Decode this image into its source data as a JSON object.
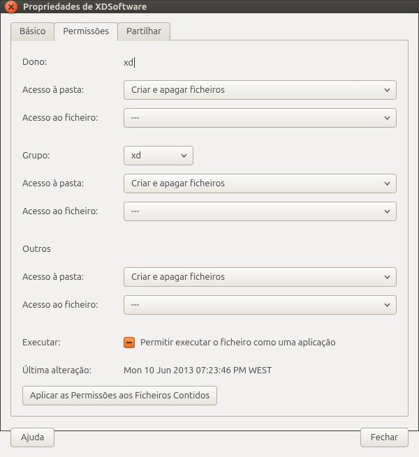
{
  "window": {
    "title": "Propriedades de XDSoftware"
  },
  "tabs": {
    "basic": "Básico",
    "permissions": "Permissões",
    "share": "Partilhar"
  },
  "labels": {
    "owner": "Dono:",
    "folder_access": "Acesso à pasta:",
    "file_access": "Acesso ao ficheiro:",
    "group": "Grupo:",
    "others": "Outros",
    "execute": "Executar:",
    "last_change": "Última alteração:"
  },
  "values": {
    "owner": "xd",
    "owner_folder_access": "Criar e apagar ficheiros",
    "owner_file_access": "---",
    "group": "xd",
    "group_folder_access": "Criar e apagar ficheiros",
    "group_file_access": "---",
    "others_folder_access": "Criar e apagar ficheiros",
    "others_file_access": "---",
    "execute_label": "Permitir executar o ficheiro como uma aplicação",
    "last_change": "Mon 10 Jun 2013 07:23:46 PM WEST"
  },
  "buttons": {
    "apply_contained": "Aplicar as Permissões aos Ficheiros Contidos",
    "help": "Ajuda",
    "close": "Fechar"
  }
}
